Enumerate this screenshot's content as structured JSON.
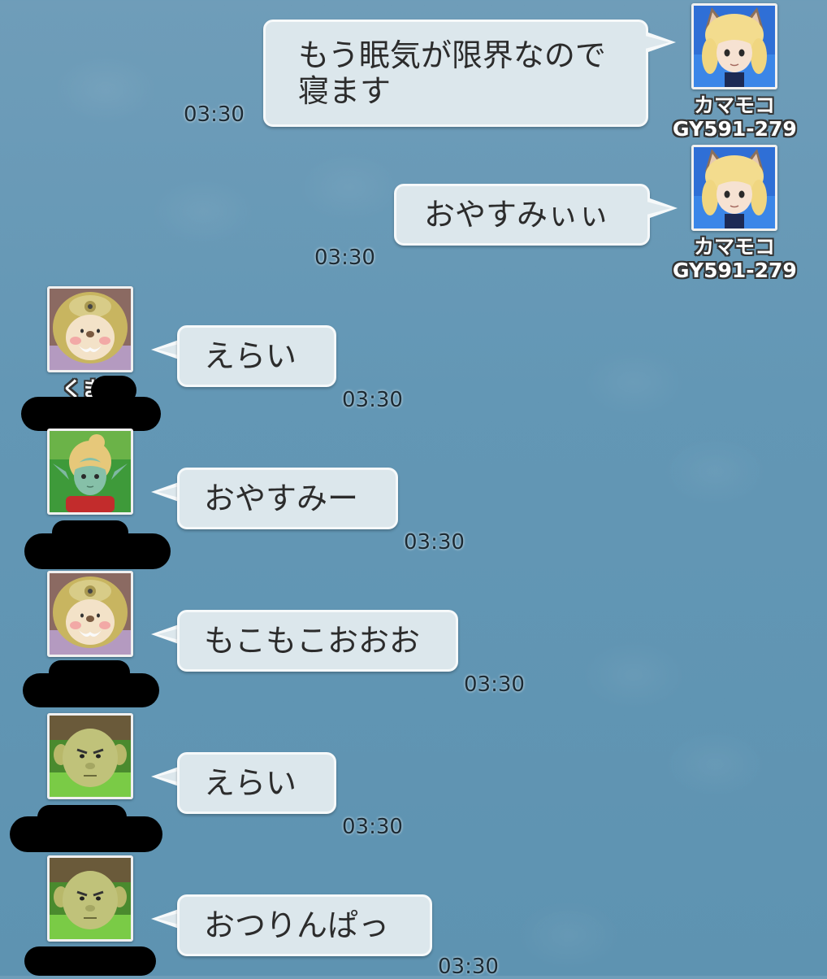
{
  "colors": {
    "background": "#6397b5",
    "bubble_fill": "#dce7ec",
    "bubble_border": "#f6f9fa",
    "timestamp_text": "#1c2a33",
    "redaction": "#000000"
  },
  "messages": [
    {
      "side": "right",
      "sender": {
        "name": "カマモコ",
        "id": "GY591-279",
        "avatar": "cat-ear-blonde-avatar"
      },
      "lines": [
        "もう眠気が限界なので",
        "寝ます"
      ],
      "time": "03:30"
    },
    {
      "side": "right",
      "sender": {
        "name": "カマモコ",
        "id": "GY591-279",
        "avatar": "cat-ear-blonde-avatar"
      },
      "lines": [
        "おやすみぃぃ"
      ],
      "time": "03:30"
    },
    {
      "side": "left",
      "sender": {
        "name_visible": "くま",
        "avatar": "bear-hood-avatar",
        "name_redacted": true
      },
      "lines": [
        "えらい"
      ],
      "time": "03:30"
    },
    {
      "side": "left",
      "sender": {
        "avatar": "green-skin-elf-avatar",
        "name_redacted": true
      },
      "lines": [
        "おやすみー"
      ],
      "time": "03:30"
    },
    {
      "side": "left",
      "sender": {
        "avatar": "bear-hood-avatar",
        "name_redacted": true
      },
      "lines": [
        "もこもこおおお"
      ],
      "time": "03:30"
    },
    {
      "side": "left",
      "sender": {
        "avatar": "ogre-avatar",
        "name_redacted": true
      },
      "lines": [
        "えらい"
      ],
      "time": "03:30"
    },
    {
      "side": "left",
      "sender": {
        "avatar": "ogre-avatar",
        "name_redacted": true
      },
      "lines": [
        "おつりんぱっ"
      ],
      "time": "03:30"
    }
  ]
}
